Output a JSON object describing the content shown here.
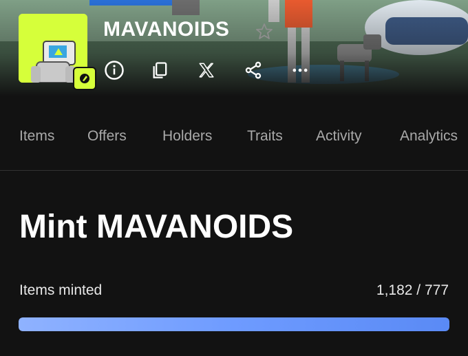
{
  "collection": {
    "name": "MAVANOIDS"
  },
  "actions": [
    {
      "name": "info",
      "icon": "info-icon"
    },
    {
      "name": "copy",
      "icon": "copy-icon"
    },
    {
      "name": "x",
      "icon": "x-logo-icon"
    },
    {
      "name": "share",
      "icon": "share-icon"
    },
    {
      "name": "more",
      "icon": "more-icon"
    }
  ],
  "tabs": [
    {
      "label": "Items"
    },
    {
      "label": "Offers"
    },
    {
      "label": "Holders"
    },
    {
      "label": "Traits"
    },
    {
      "label": "Activity"
    },
    {
      "label": "Analytics"
    }
  ],
  "mint": {
    "title": "Mint MAVANOIDS",
    "items_minted_label": "Items minted",
    "items_minted_value": "1,182 / 777",
    "progress": 1.0
  },
  "colors": {
    "background": "#121212",
    "accent_lime": "#d6ff3a",
    "progress": "#6e9bff",
    "tab_text": "#a9a9a9"
  }
}
